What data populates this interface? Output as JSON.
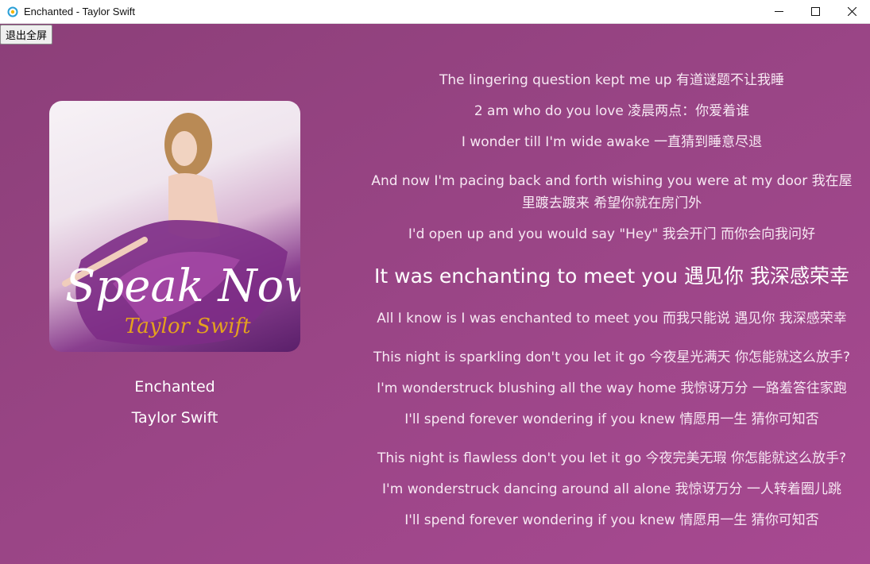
{
  "window": {
    "title": "Enchanted - Taylor Swift",
    "icon": "app-icon",
    "controls": [
      "minimize-icon",
      "maximize-icon",
      "close-icon"
    ]
  },
  "toolbar": {
    "exit_fullscreen_label": "退出全屏"
  },
  "album": {
    "cover_text": "Speak Now",
    "cover_artist_text": "Taylor Swift"
  },
  "song": {
    "title": "Enchanted",
    "artist": "Taylor Swift"
  },
  "lyrics": {
    "lines": [
      "The lingering question kept me up 有道谜题不让我睡",
      "2 am who do you love 凌晨两点：你爱着谁",
      "I wonder till I'm wide awake 一直猜到睡意尽退",
      "And now I'm pacing back and forth wishing you were at my door 我在屋里踱去踱来 希望你就在房门外",
      "I'd open up and you would say \"Hey\" 我会开门 而你会向我问好",
      "It was enchanting to meet you 遇见你 我深感荣幸",
      "All I know is I was enchanted to meet you 而我只能说 遇见你 我深感荣幸",
      "This night is sparkling don't you let it go 今夜星光满天 你怎能就这么放手?",
      "I'm wonderstruck blushing all the way home 我惊讶万分 一路羞答往家跑",
      "I'll spend forever wondering if you knew 情愿用一生 猜你可知否",
      "This night is flawless don't you let it go 今夜完美无瑕 你怎能就这么放手?",
      "I'm wonderstruck dancing around all alone 我惊讶万分 一人转着圈儿跳",
      "I'll spend forever wondering if you knew 情愿用一生 猜你可知否"
    ],
    "active_index": 5
  },
  "colors": {
    "background_start": "#8c3f79",
    "background_end": "#a74991",
    "lyric_text": "#f7e8f3",
    "active_lyric": "#ffffff"
  }
}
